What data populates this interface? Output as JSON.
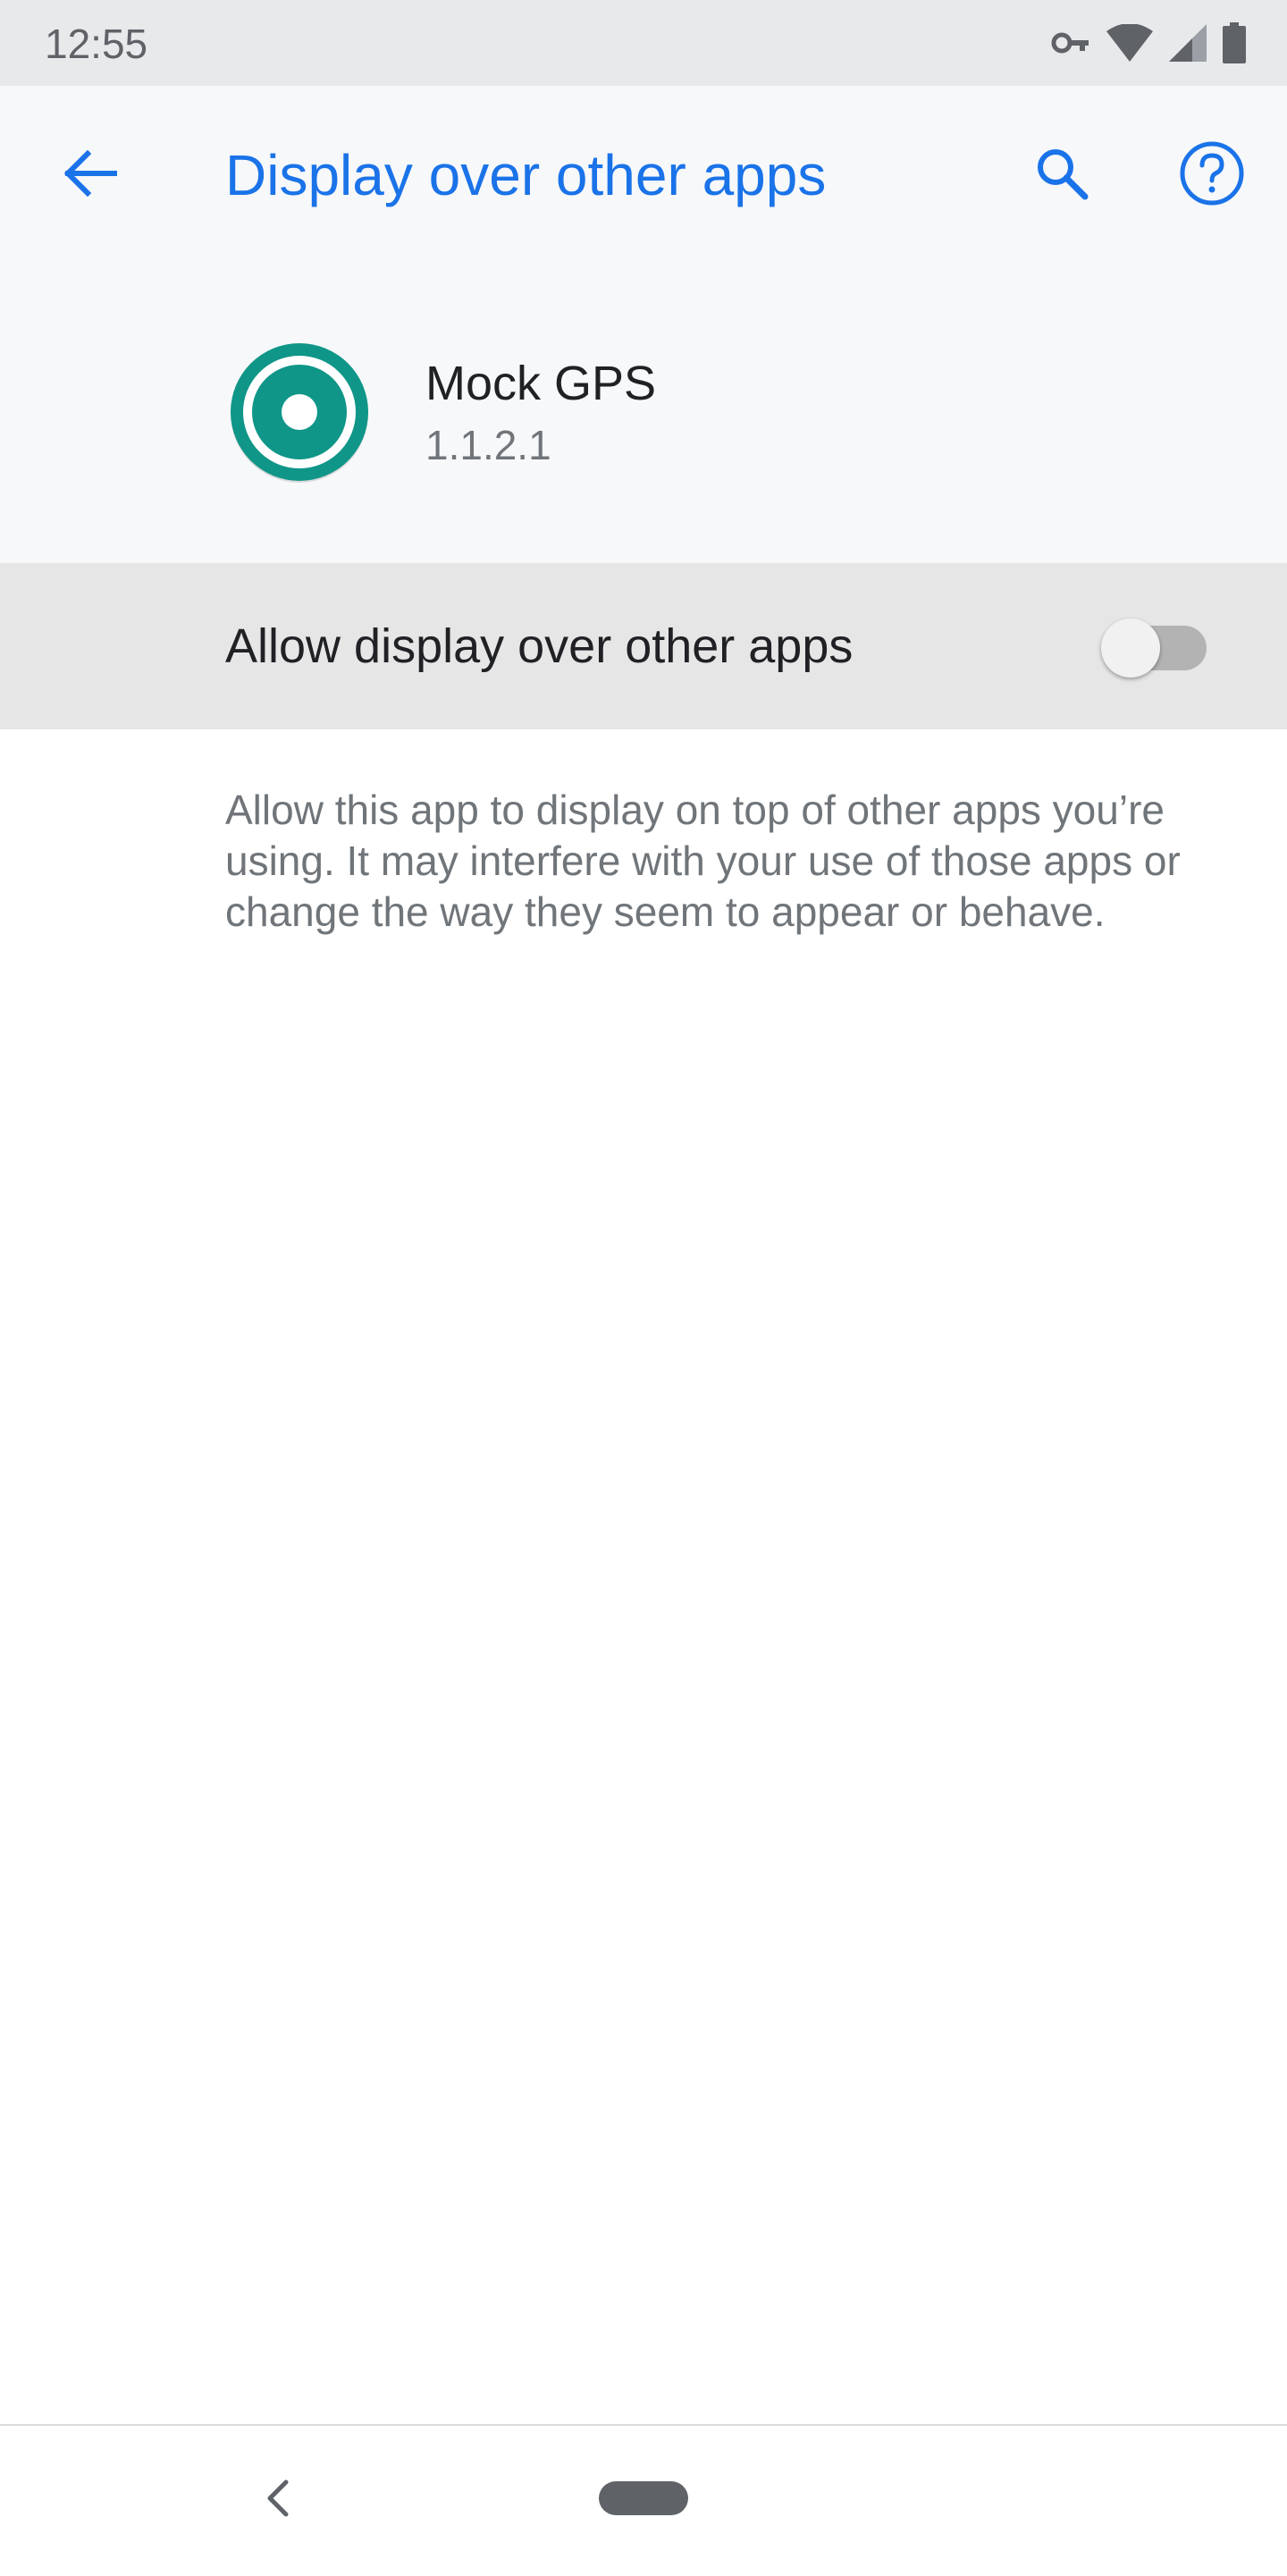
{
  "status_bar": {
    "time": "12:55",
    "icons": [
      "vpn-key-icon",
      "wifi-icon",
      "cell-signal-icon",
      "battery-icon"
    ]
  },
  "toolbar": {
    "title": "Display over other apps",
    "back_icon": "arrow-back-icon",
    "search_icon": "search-icon",
    "help_icon": "help-icon"
  },
  "app": {
    "name": "Mock GPS",
    "version": "1.1.2.1",
    "icon": "mock-gps-app-icon"
  },
  "setting": {
    "label": "Allow display over other apps",
    "enabled": false
  },
  "description": "Allow this app to display on top of other apps you’re using. It may interfere with your use of those apps or change the way they seem to appear or behave.",
  "navigation": {
    "back_icon": "nav-back-icon",
    "home_icon": "nav-home-pill"
  },
  "colors": {
    "accent": "#1a73e8",
    "app_icon": "#0f9688",
    "header_bg": "#f7f8fa",
    "status_bar_bg": "#e8e9eb",
    "toggle_row_bg": "#e6e6e6"
  }
}
